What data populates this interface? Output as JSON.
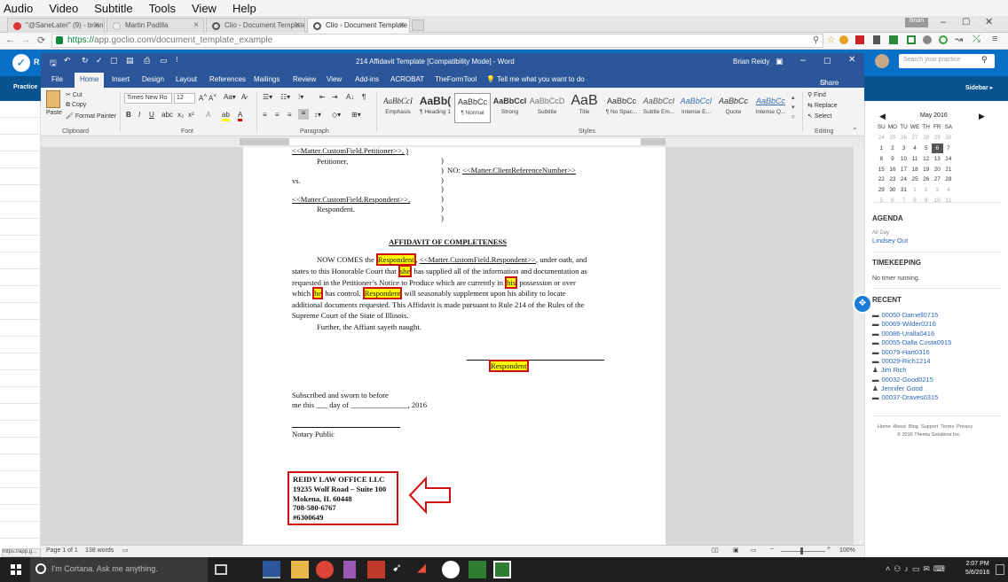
{
  "menubar": {
    "items": [
      "Audio",
      "Video",
      "Subtitle",
      "Tools",
      "View",
      "Help"
    ]
  },
  "browser": {
    "tabs": [
      {
        "title": "\"@SaneLater\" (9) - brian@...",
        "active": false
      },
      {
        "title": "Martin Padilla",
        "active": false
      },
      {
        "title": "Clio - Document Template",
        "active": false
      },
      {
        "title": "Clio - Document Template",
        "active": true
      }
    ],
    "profile": "Brian",
    "url_scheme": "https://",
    "url_rest": "app.goclio.com/document_template_example"
  },
  "clio": {
    "logo": "R",
    "practice_label": "Practice",
    "sidebar_label": "Sidebar ▸",
    "search_placeholder": "Search your practice"
  },
  "word": {
    "title": "214 Affidavit Template [Compatibility Mode] - Word",
    "user": "Brian Reidy",
    "tabs": [
      "File",
      "Home",
      "Insert",
      "Design",
      "Layout",
      "References",
      "Mailings",
      "Review",
      "View",
      "Add-ins",
      "ACROBAT",
      "TheFormTool"
    ],
    "tell_me": "Tell me what you want to do",
    "share": "Share",
    "clipboard": {
      "paste": "Paste",
      "cut": "Cut",
      "copy": "Copy",
      "format_painter": "Format Painter",
      "group": "Clipboard"
    },
    "font": {
      "name": "Times New Ro",
      "size": "12",
      "group": "Font"
    },
    "paragraph_group": "Paragraph",
    "styles": [
      {
        "preview": "AaBbCcI",
        "name": "Emphasis"
      },
      {
        "preview": "AaBb(",
        "name": "¶ Heading 1"
      },
      {
        "preview": "AaBbCc",
        "name": "¶ Normal"
      },
      {
        "preview": "AaBbCcl",
        "name": "Strong"
      },
      {
        "preview": "AaBbCcD",
        "name": "Subtitle"
      },
      {
        "preview": "AaB",
        "name": "Title"
      },
      {
        "preview": "AaBbCc",
        "name": "¶ No Spac..."
      },
      {
        "preview": "AaBbCcI",
        "name": "Subtle Em..."
      },
      {
        "preview": "AaBbCcI",
        "name": "Intense E..."
      },
      {
        "preview": "AaBbCc",
        "name": "Quote"
      },
      {
        "preview": "AaBbCc",
        "name": "Intense Q..."
      }
    ],
    "styles_group": "Styles",
    "editing": {
      "find": "Find",
      "replace": "Replace",
      "select": "Select",
      "group": "Editing"
    },
    "status": {
      "page": "Page 1 of 1",
      "words": "138 words",
      "zoom": "100%"
    }
  },
  "document": {
    "line1": "<<Matter.CustomField.Petitioner>>, )",
    "line2": "Petitioner,",
    "no_label": "NO: ",
    "no_field": "<<Matter.ClientReferenceNumber>>",
    "vs": "vs.",
    "respondent_field": "<<Matter.CustomField.Respondent>>,",
    "respondent": "Respondent.",
    "heading": "AFFIDAVIT OF COMPLETENESS",
    "p1a": "NOW COMES the ",
    "w_resp": "Respondent",
    "p1b": ", ",
    "p1c": "<<Matter.CustomField.Respondent>>",
    "p1d": ", under oath, and",
    "p2a": "states to this Honorable Court that ",
    "w_she": "she",
    "p2b": " has supplied all of the information and documentation as",
    "p3a": "requested in the Petitioner’s Notice to Produce which are currently in ",
    "w_his": "his",
    "p3b": " possession or over",
    "p4a": "which ",
    "w_he": "he",
    "p4b": " has control. ",
    "w_resp2": "Respondent",
    "p4c": " will seasonably supplement upon his ability to locate",
    "p5": "additional documents requested. This Affidavit is made pursuant to Rule 214 of the Rules of the",
    "p6": "Supreme Court of the State of Illinois.",
    "p7": "Further, the Affiant sayeth naught.",
    "sig": "Respondent",
    "sub1": "Subscribed and sworn to before",
    "sub2": "me this ___ day of _______________, 2016",
    "notary": "Notary Public",
    "firm": [
      "REIDY LAW OFFICE LLC",
      "19235 Wolf Road – Suite 100",
      "Mokena, IL 60448",
      "708-580-6767",
      "#6300649"
    ]
  },
  "sidebar": {
    "month": "May 2016",
    "weekdays": [
      "SU",
      "MO",
      "TU",
      "WE",
      "TH",
      "FR",
      "SA"
    ],
    "weeks": [
      [
        "24",
        "25",
        "26",
        "27",
        "28",
        "29",
        "30"
      ],
      [
        "1",
        "2",
        "3",
        "4",
        "5",
        "6",
        "7"
      ],
      [
        "8",
        "9",
        "10",
        "11",
        "12",
        "13",
        "14"
      ],
      [
        "15",
        "16",
        "17",
        "18",
        "19",
        "20",
        "21"
      ],
      [
        "22",
        "23",
        "24",
        "25",
        "26",
        "27",
        "28"
      ],
      [
        "29",
        "30",
        "31",
        "1",
        "2",
        "3",
        "4"
      ],
      [
        "5",
        "6",
        "7",
        "8",
        "9",
        "10",
        "11"
      ]
    ],
    "agenda_title": "AGENDA",
    "agenda_allday": "All Day",
    "agenda_item": "Lindsey Out",
    "timekeeping_title": "TIMEKEEPING",
    "timekeeping_text": "No timer running.",
    "recent_title": "RECENT",
    "recent": [
      "00050-Darnell0715",
      "00069-Wilder0216",
      "00086-Uralla0416",
      "00055-Dalla Costa0915",
      "00079-Hart0316",
      "00029-Rich1214",
      "Jim Rich",
      "00032-Good0215",
      "Jennifer Good",
      "00037-Draves0315"
    ],
    "footer_links": "Home  About  Blog  Support  Terms  Privacy",
    "footer_copy": "© 2016 Themis Solutions Inc."
  },
  "taskbar": {
    "cortana": "I'm Cortana. Ask me anything.",
    "time": "2:07 PM",
    "date": "5/6/2016",
    "url_peek": "https://app.g..."
  }
}
